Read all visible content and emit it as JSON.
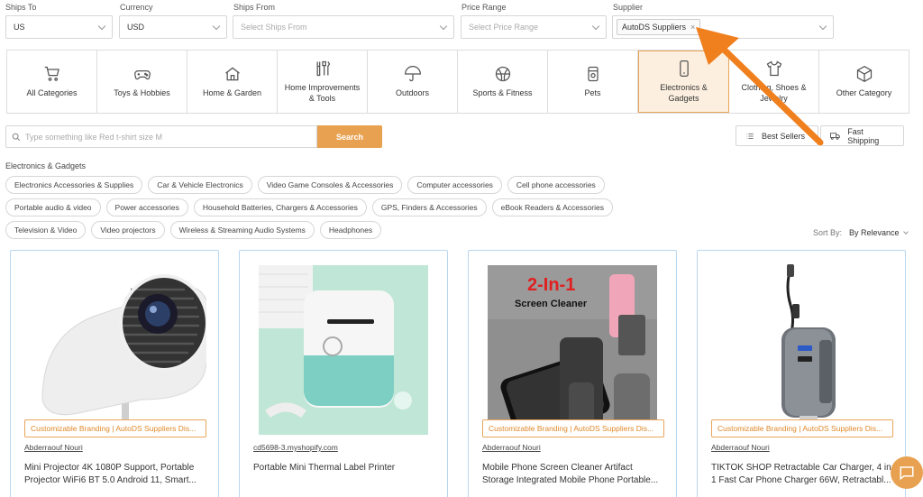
{
  "filters": {
    "ships_to": {
      "label": "Ships To",
      "value": "US"
    },
    "currency": {
      "label": "Currency",
      "value": "USD"
    },
    "ships_from": {
      "label": "Ships From",
      "placeholder": "Select Ships From"
    },
    "price_range": {
      "label": "Price Range",
      "placeholder": "Select Price Range"
    },
    "supplier": {
      "label": "Supplier",
      "tag": "AutoDS Suppliers",
      "tag_remove": "×"
    }
  },
  "categories": [
    {
      "label": "All Categories",
      "icon": "cart-icon"
    },
    {
      "label": "Toys & Hobbies",
      "icon": "gamepad-icon"
    },
    {
      "label": "Home & Garden",
      "icon": "house-icon"
    },
    {
      "label": "Home Improvements & Tools",
      "icon": "tools-icon"
    },
    {
      "label": "Outdoors",
      "icon": "umbrella-icon"
    },
    {
      "label": "Sports & Fitness",
      "icon": "ball-icon"
    },
    {
      "label": "Pets",
      "icon": "pet-food-icon"
    },
    {
      "label": "Electronics & Gadgets",
      "icon": "phone-icon",
      "active": true
    },
    {
      "label": "Clothing, Shoes & Jewelry",
      "icon": "shirt-icon"
    },
    {
      "label": "Other Category",
      "icon": "box-icon"
    }
  ],
  "search": {
    "placeholder": "Type something like Red t-shirt size M",
    "button": "Search"
  },
  "quick_filters": {
    "best_sellers": "Best Sellers",
    "fast_shipping": "Fast Shipping"
  },
  "breadcrumb": "Electronics & Gadgets",
  "subcategories": [
    "Electronics Accessories & Supplies",
    "Car & Vehicle Electronics",
    "Video Game Consoles & Accessories",
    "Computer accessories",
    "Cell phone accessories",
    "Portable audio & video",
    "Power accessories",
    "Household Batteries, Chargers & Accessories",
    "GPS, Finders & Accessories",
    "eBook Readers & Accessories",
    "Television & Video",
    "Video projectors",
    "Wireless & Streaming Audio Systems",
    "Headphones"
  ],
  "sort": {
    "label": "Sort By:",
    "value": "By Relevance"
  },
  "products": [
    {
      "branding": "Customizable Branding | AutoDS Suppliers Dis...",
      "supplier": "Abderraouf Nouri",
      "title": "Mini Projector 4K 1080P Support, Portable Projector WiFi6 BT 5.0 Android 11, Smart..."
    },
    {
      "branding": "",
      "supplier": "cd5698-3.myshopify.com",
      "title": "Portable Mini Thermal Label Printer"
    },
    {
      "branding": "Customizable Branding | AutoDS Suppliers Dis...",
      "supplier": "Abderraouf Nouri",
      "title": "Mobile Phone Screen Cleaner Artifact Storage Integrated Mobile Phone Portable..."
    },
    {
      "branding": "Customizable Branding | AutoDS Suppliers Dis...",
      "supplier": "Abderraouf Nouri",
      "title": "TIKTOK SHOP Retractable Car Charger, 4 in 1 Fast Car Phone Charger 66W, Retractabl..."
    }
  ],
  "product3_image_text": {
    "line1": "2-In-1",
    "line2": "Screen Cleaner"
  },
  "colors": {
    "accent": "#e8a150",
    "active_bg": "#fcefdf",
    "card_border": "#b9d7f0",
    "arrow": "#f07f1e"
  }
}
